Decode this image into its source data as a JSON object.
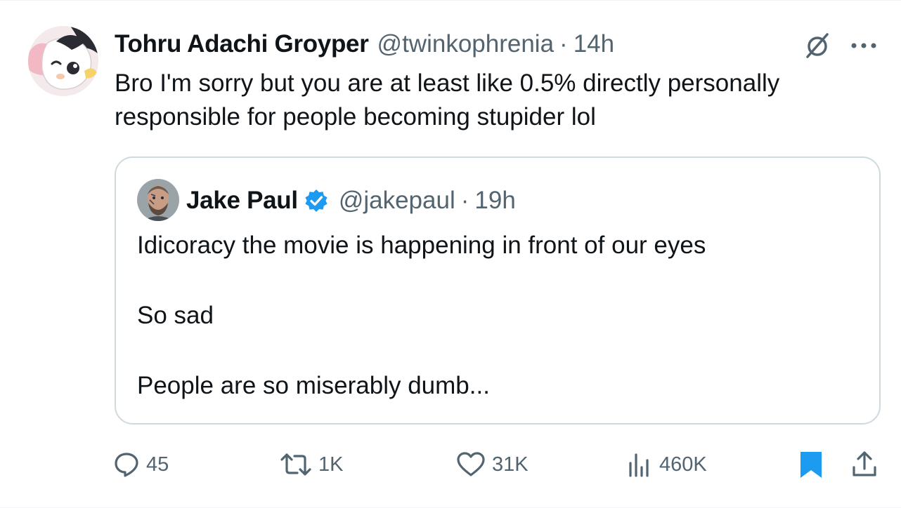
{
  "tweet": {
    "author_name": "Tohru Adachi Groyper",
    "handle": "@twinkophrenia",
    "separator": "·",
    "time": "14h",
    "text": "Bro I'm sorry but you are at least like 0.5% directly personally responsible for people becoming stupider lol",
    "avatar_icon": "avatar-anime-creature-icon",
    "grok_icon": "grok-icon",
    "more_icon": "more-dots-icon"
  },
  "quoted_tweet": {
    "author_name": "Jake Paul",
    "handle": "@jakepaul",
    "separator": "·",
    "time": "19h",
    "verified_icon": "verified-badge-icon",
    "verified_color": "#1d9bf0",
    "paragraphs": [
      "Idicoracy the movie is happening in front of our eyes",
      "So sad",
      "People are so miserably dumb..."
    ]
  },
  "actions": {
    "replies": "45",
    "reposts": "1K",
    "likes": "31K",
    "views": "460K",
    "bookmark_color": "#1d9bf0",
    "icons": [
      "reply-icon",
      "repost-icon",
      "like-icon",
      "views-icon",
      "bookmark-icon",
      "share-icon"
    ]
  },
  "colors": {
    "text": "#0f1419",
    "secondary": "#536471",
    "border": "#cfd9de",
    "accent": "#1d9bf0"
  }
}
